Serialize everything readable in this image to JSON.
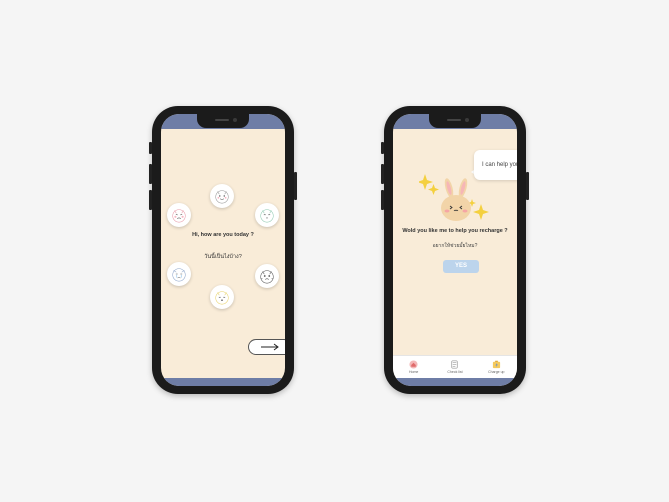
{
  "left_screen": {
    "question_en": "Hi, how are you today ?",
    "question_th": "วันนี้เป็นไงบ้าง?",
    "moods": [
      {
        "name": "happy",
        "icon": "smiling-face-icon"
      },
      {
        "name": "angry",
        "icon": "angry-face-icon"
      },
      {
        "name": "calm",
        "icon": "calm-face-icon"
      },
      {
        "name": "sad",
        "icon": "crying-face-icon"
      },
      {
        "name": "worried",
        "icon": "worried-face-icon"
      },
      {
        "name": "sleepy",
        "icon": "sleepy-face-icon"
      }
    ],
    "next_icon": "arrow-right-icon"
  },
  "right_screen": {
    "bubble_text": "I can help you",
    "question_en": "Wold you like me to help you recharge ?",
    "question_th": "อยากให้ช่วยมั้ยไหม?",
    "yes_label": "YES",
    "tabs": [
      {
        "label": "Home",
        "icon": "home-icon"
      },
      {
        "label": "Check list",
        "icon": "checklist-icon"
      },
      {
        "label": "Charge up",
        "icon": "battery-icon"
      }
    ]
  },
  "colors": {
    "screen_bg": "#f9ecd8",
    "status_bar": "#6e7da6",
    "yes_button": "#bcd4ec",
    "star": "#f4d03f"
  }
}
